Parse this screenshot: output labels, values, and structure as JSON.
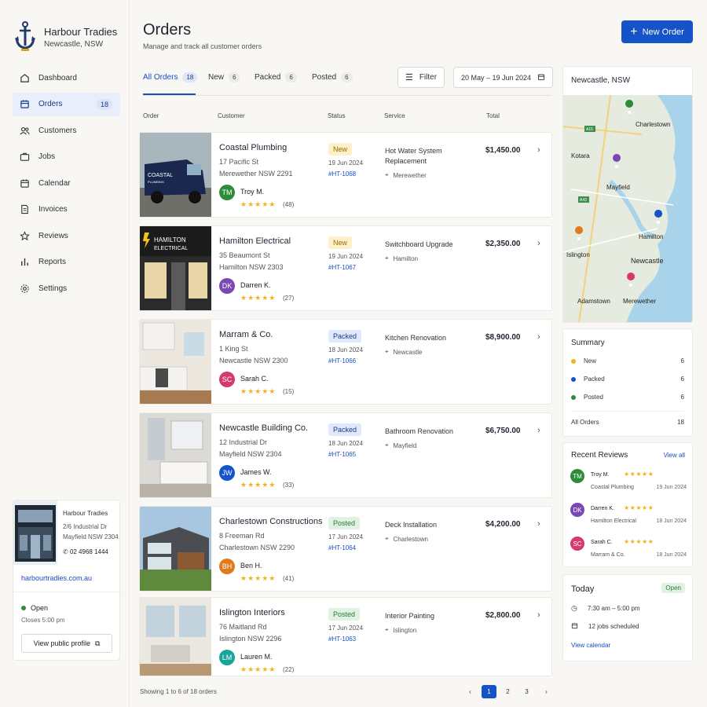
{
  "brand": {
    "name": "Harbour Tradies",
    "location": "Newcastle, NSW"
  },
  "nav": [
    {
      "label": "Dashboard",
      "icon": "home-icon"
    },
    {
      "label": "Orders",
      "icon": "orders-icon",
      "badge": "18",
      "active": true
    },
    {
      "label": "Customers",
      "icon": "users-icon"
    },
    {
      "label": "Jobs",
      "icon": "briefcase-icon"
    },
    {
      "label": "Calendar",
      "icon": "calendar-icon"
    },
    {
      "label": "Invoices",
      "icon": "invoice-icon"
    },
    {
      "label": "Reviews",
      "icon": "star-icon"
    },
    {
      "label": "Reports",
      "icon": "bar-chart-icon"
    },
    {
      "label": "Settings",
      "icon": "gear-icon"
    }
  ],
  "profile": {
    "name": "Harbour Tradies",
    "address1": "2/6 Industrial Dr",
    "address2": "Mayfield NSW 2304",
    "phone": "02 4968 1444",
    "website": "harbourtradies.com.au",
    "status": "Open",
    "closes": "Closes 5:00 pm",
    "button": "View public profile"
  },
  "header": {
    "title": "Orders",
    "subtitle": "Manage and track all customer orders",
    "new_order": "New Order"
  },
  "tabs": [
    {
      "label": "All Orders",
      "count": "18"
    },
    {
      "label": "New",
      "count": "6"
    },
    {
      "label": "Packed",
      "count": "6"
    },
    {
      "label": "Posted",
      "count": "6"
    }
  ],
  "toolbar": {
    "filter": "Filter",
    "date_range": "20 May – 19 Jun 2024"
  },
  "columns": {
    "order": "Order",
    "customer": "Customer",
    "status": "Status",
    "service": "Service",
    "total": "Total"
  },
  "orders": [
    {
      "name": "Coastal Plumbing",
      "street": "17 Pacific St",
      "suburb": "Merewether NSW 2291",
      "initials": "TM",
      "person": "Troy M.",
      "reviews": "(48)",
      "status": "New",
      "date": "19 Jun 2024",
      "id": "#HT-1068",
      "service": "Hot Water System Replacement",
      "location": "Merewether",
      "total": "$1,450.00"
    },
    {
      "name": "Hamilton Electrical",
      "street": "35 Beaumont St",
      "suburb": "Hamilton NSW 2303",
      "initials": "DK",
      "person": "Darren K.",
      "reviews": "(27)",
      "status": "New",
      "date": "19 Jun 2024",
      "id": "#HT-1067",
      "service": "Switchboard Upgrade",
      "location": "Hamilton",
      "total": "$2,350.00"
    },
    {
      "name": "Marram & Co.",
      "street": "1 King St",
      "suburb": "Newcastle NSW 2300",
      "initials": "SC",
      "person": "Sarah C.",
      "reviews": "(15)",
      "status": "Packed",
      "date": "18 Jun 2024",
      "id": "#HT-1066",
      "service": "Kitchen Renovation",
      "location": "Newcastle",
      "total": "$8,900.00"
    },
    {
      "name": "Newcastle Building Co.",
      "street": "12 Industrial Dr",
      "suburb": "Mayfield NSW 2304",
      "initials": "JW",
      "person": "James W.",
      "reviews": "(33)",
      "status": "Packed",
      "date": "18 Jun 2024",
      "id": "#HT-1065",
      "service": "Bathroom Renovation",
      "location": "Mayfield",
      "total": "$6,750.00"
    },
    {
      "name": "Charlestown Constructions",
      "street": "8 Freeman Rd",
      "suburb": "Charlestown NSW 2290",
      "initials": "BH",
      "person": "Ben H.",
      "reviews": "(41)",
      "status": "Posted",
      "date": "17 Jun 2024",
      "id": "#HT-1064",
      "service": "Deck Installation",
      "location": "Charlestown",
      "total": "$4,200.00"
    },
    {
      "name": "Islington Interiors",
      "street": "76 Maitland Rd",
      "suburb": "Islington NSW 2296",
      "initials": "LM",
      "person": "Lauren M.",
      "reviews": "(22)",
      "status": "Posted",
      "date": "17 Jun 2024",
      "id": "#HT-1063",
      "service": "Interior Painting",
      "location": "Islington",
      "total": "$2,800.00"
    }
  ],
  "van_text": {
    "line1": "COASTAL",
    "line2": "PLUMBING"
  },
  "sign_text": {
    "line1": "HAMILTON",
    "line2": "ELECTRICAL"
  },
  "pagination": {
    "summary": "Showing 1 to 6 of 18 orders",
    "pages": [
      "1",
      "2",
      "3"
    ],
    "current": "1"
  },
  "map": {
    "title": "Newcastle, NSW",
    "labels": [
      "Charlestown",
      "Kotara",
      "Mayfield",
      "Hamilton",
      "Islington",
      "Newcastle",
      "Adamstown",
      "Merewether"
    ],
    "roads": [
      "A15",
      "A43"
    ]
  },
  "summary": {
    "title": "Summary",
    "rows": [
      {
        "label": "New",
        "value": "6",
        "color": "#f2b21d"
      },
      {
        "label": "Packed",
        "value": "6",
        "color": "#1553c8"
      },
      {
        "label": "Posted",
        "value": "6",
        "color": "#2e8b3a"
      }
    ],
    "total_label": "All Orders",
    "total_value": "18"
  },
  "recent_reviews": {
    "title": "Recent Reviews",
    "view_all": "View all",
    "items": [
      {
        "initials": "TM",
        "name": "Troy M.",
        "company": "Coastal Plumbing",
        "date": "19 Jun 2024"
      },
      {
        "initials": "DK",
        "name": "Darren K.",
        "company": "Hamilton Electrical",
        "date": "18 Jun 2024"
      },
      {
        "initials": "SC",
        "name": "Sarah C.",
        "company": "Marram & Co.",
        "date": "18 Jun 2024"
      }
    ]
  },
  "today": {
    "title": "Today",
    "status": "Open",
    "hours": "7:30 am – 5:00 pm",
    "jobs": "12 jobs scheduled",
    "link": "View calendar"
  },
  "rating_stars": "★★★★★",
  "colors": {
    "accent": "#1553c8",
    "new": "#f2b21d",
    "packed": "#1553c8",
    "posted": "#2e8b3a"
  }
}
